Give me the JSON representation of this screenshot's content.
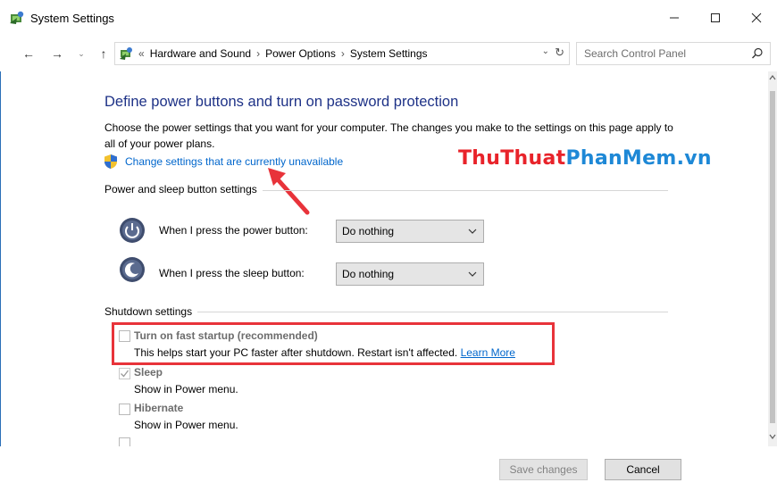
{
  "window": {
    "title": "System Settings",
    "minimize_glyph": "—",
    "maximize_glyph": "☐",
    "close_glyph": "✕"
  },
  "address": {
    "back_glyph": "←",
    "forward_glyph": "→",
    "recent_glyph": "⌄",
    "up_glyph": "↑",
    "overflow": "«",
    "crumbs": [
      "Hardware and Sound",
      "Power Options",
      "System Settings"
    ],
    "separator": "›",
    "dropdown_glyph": "⌄",
    "refresh_glyph": "↻",
    "search_placeholder": "Search Control Panel"
  },
  "main": {
    "heading": "Define power buttons and turn on password protection",
    "description": "Choose the power settings that you want for your computer. The changes you make to the settings on this page apply to all of your power plans.",
    "change_link": "Change settings that are currently unavailable",
    "watermark_part1": "ThuThuat",
    "watermark_part2": "PhanMem.vn"
  },
  "power_section": {
    "label": "Power and sleep button settings",
    "power_row_label": "When I press the power button:",
    "power_value": "Do nothing",
    "sleep_row_label": "When I press the sleep button:",
    "sleep_value": "Do nothing"
  },
  "shutdown_section": {
    "label": "Shutdown settings",
    "fast_startup_title": "Turn on fast startup (recommended)",
    "fast_startup_desc": "This helps start your PC faster after shutdown. Restart isn't affected.",
    "learn_more": "Learn More",
    "sleep_title": "Sleep",
    "sleep_desc": "Show in Power menu.",
    "hibernate_title": "Hibernate",
    "hibernate_desc": "Show in Power menu.",
    "fast_startup_checked": false,
    "sleep_checked": true,
    "hibernate_checked": false
  },
  "footer": {
    "save_label": "Save changes",
    "cancel_label": "Cancel"
  },
  "colors": {
    "heading": "#1e3287",
    "link": "#0066cc",
    "highlight": "#e8333a",
    "watermark_red": "#e8232a",
    "watermark_blue": "#1e88d6"
  }
}
